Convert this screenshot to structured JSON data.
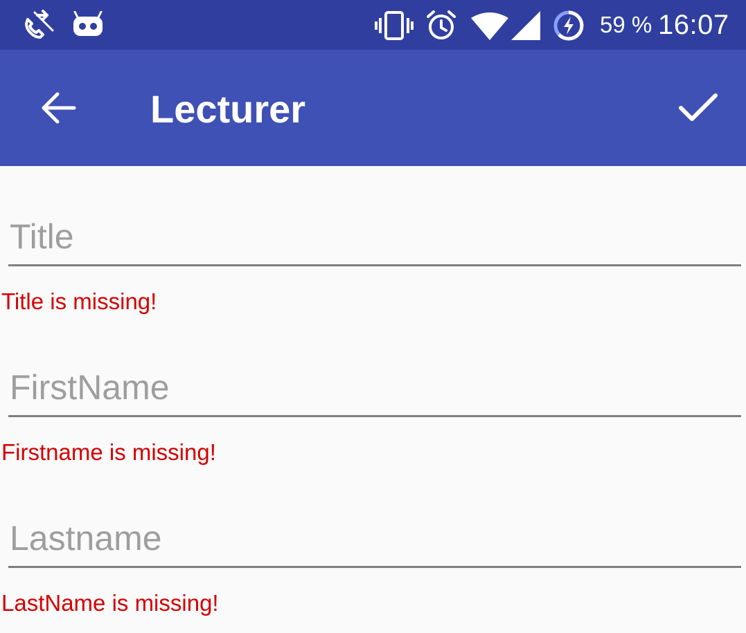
{
  "status_bar": {
    "icons": [
      "call-forwarding-icon",
      "cyanogenmod-icon",
      "vibrate-icon",
      "alarm-icon",
      "wifi-icon",
      "cell-signal-icon",
      "battery-charging-icon"
    ],
    "battery": "59 %",
    "time": "16:07"
  },
  "app_bar": {
    "title": "Lecturer",
    "back_icon": "arrow-back-icon",
    "done_icon": "check-icon"
  },
  "form": {
    "title": {
      "placeholder": "Title",
      "value": "",
      "error": "Title is missing!"
    },
    "first_name": {
      "placeholder": "FirstName",
      "value": "",
      "error": "Firstname is missing!"
    },
    "last_name": {
      "placeholder": "Lastname",
      "value": "",
      "error": "LastName is missing!"
    }
  },
  "colors": {
    "status_bar": "#303f9f",
    "app_bar": "#3f51b5",
    "error": "#d50000",
    "hint": "#9e9e9e",
    "underline": "#7f7f7f",
    "background": "#fafafa"
  }
}
